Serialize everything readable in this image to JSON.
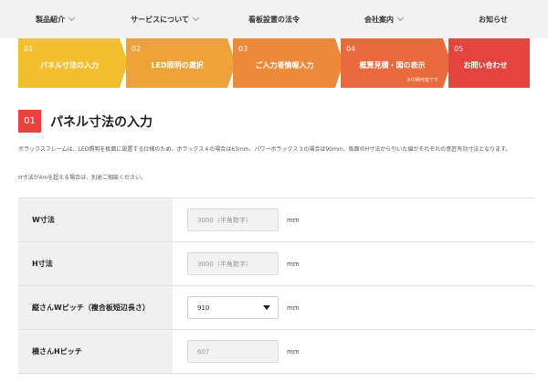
{
  "nav": [
    {
      "label": "製品紹介",
      "dropdown": true
    },
    {
      "label": "サービスについて",
      "dropdown": true
    },
    {
      "label": "看板設置の法令",
      "dropdown": false
    },
    {
      "label": "会社案内",
      "dropdown": true
    },
    {
      "label": "お知らせ",
      "dropdown": false
    }
  ],
  "steps": [
    {
      "num": "01",
      "label": "パネル寸法の入力",
      "color": "#f2bf2e"
    },
    {
      "num": "02",
      "label": "LED照明の選択",
      "color": "#eea23a"
    },
    {
      "num": "03",
      "label": "ご入力者情報入力",
      "color": "#ec8a3a"
    },
    {
      "num": "04",
      "label": "概算見積・図の表示",
      "note": "※印刷可能です",
      "color": "#e86a3d"
    },
    {
      "num": "05",
      "label": "お問い合わせ",
      "color": "#e4433e"
    }
  ],
  "section": {
    "num": "01",
    "title": "パネル寸法の入力"
  },
  "description": [
    "ボラックスフレームは、LED照明を板面に設置する仕様のため、ボラックス４の場合は63mm、パワーボラックス３の場合は90mm、板面のH寸法から引いた値がそれぞれの意匠有効寸法となります。",
    "H寸法が4mを超える場合は、別途ご相談ください。"
  ],
  "form": {
    "rows": [
      {
        "label": "W寸法",
        "type": "input",
        "placeholder": "3000（半角数字）",
        "unit": "mm"
      },
      {
        "label": "H寸法",
        "type": "input",
        "placeholder": "3000（半角数字）",
        "unit": "mm"
      },
      {
        "label": "縦さんWピッチ（複合板短辺長さ）",
        "type": "select",
        "value": "910",
        "unit": "mm"
      },
      {
        "label": "横さんHピッチ",
        "type": "input",
        "placeholder": "607",
        "unit": "mm"
      }
    ]
  },
  "colors": {
    "accent": "#e4433e",
    "nav_bg": "#f1f1f1",
    "label_bg": "#f0f0f0"
  }
}
